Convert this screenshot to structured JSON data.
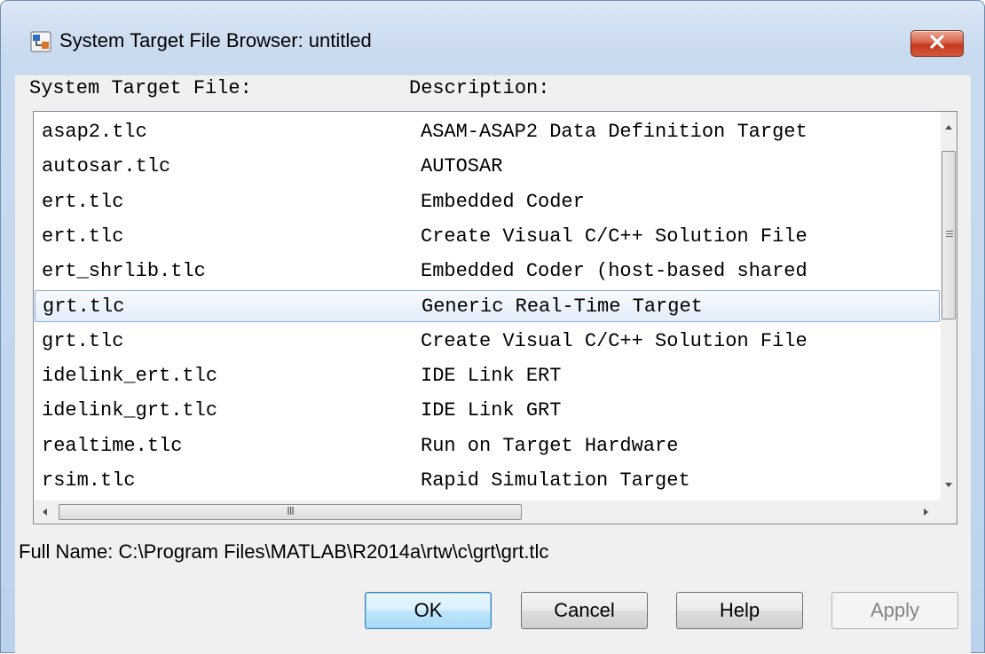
{
  "window": {
    "title": "System Target File Browser: untitled",
    "close_label": "×"
  },
  "columns": {
    "name_header": "System Target File:",
    "desc_header": "Description:"
  },
  "rows": [
    {
      "name": "asap2.tlc",
      "desc": "ASAM-ASAP2 Data Definition Target"
    },
    {
      "name": "autosar.tlc",
      "desc": "AUTOSAR"
    },
    {
      "name": "ert.tlc",
      "desc": "Embedded Coder"
    },
    {
      "name": "ert.tlc",
      "desc": "Create Visual C/C++ Solution File"
    },
    {
      "name": "ert_shrlib.tlc",
      "desc": "Embedded Coder (host-based shared"
    },
    {
      "name": "grt.tlc",
      "desc": "Generic Real-Time Target"
    },
    {
      "name": "grt.tlc",
      "desc": "Create Visual C/C++ Solution File"
    },
    {
      "name": "idelink_ert.tlc",
      "desc": "IDE Link ERT"
    },
    {
      "name": "idelink_grt.tlc",
      "desc": "IDE Link GRT"
    },
    {
      "name": "realtime.tlc",
      "desc": "Run on Target Hardware"
    },
    {
      "name": "rsim.tlc",
      "desc": "Rapid Simulation Target"
    }
  ],
  "selected_index": 5,
  "scrollbars": {
    "h_grip": "III"
  },
  "full_name": {
    "label": "Full Name:",
    "value": "C:\\Program Files\\MATLAB\\R2014a\\rtw\\c\\grt\\grt.tlc"
  },
  "buttons": {
    "ok": "OK",
    "cancel": "Cancel",
    "help": "Help",
    "apply": "Apply"
  },
  "icons": {
    "app": "matlab-simulink-icon",
    "close": "close-icon"
  },
  "colors": {
    "selection_border": "#84acdd",
    "close_button": "#c4381c",
    "disabled_text": "#838383"
  }
}
